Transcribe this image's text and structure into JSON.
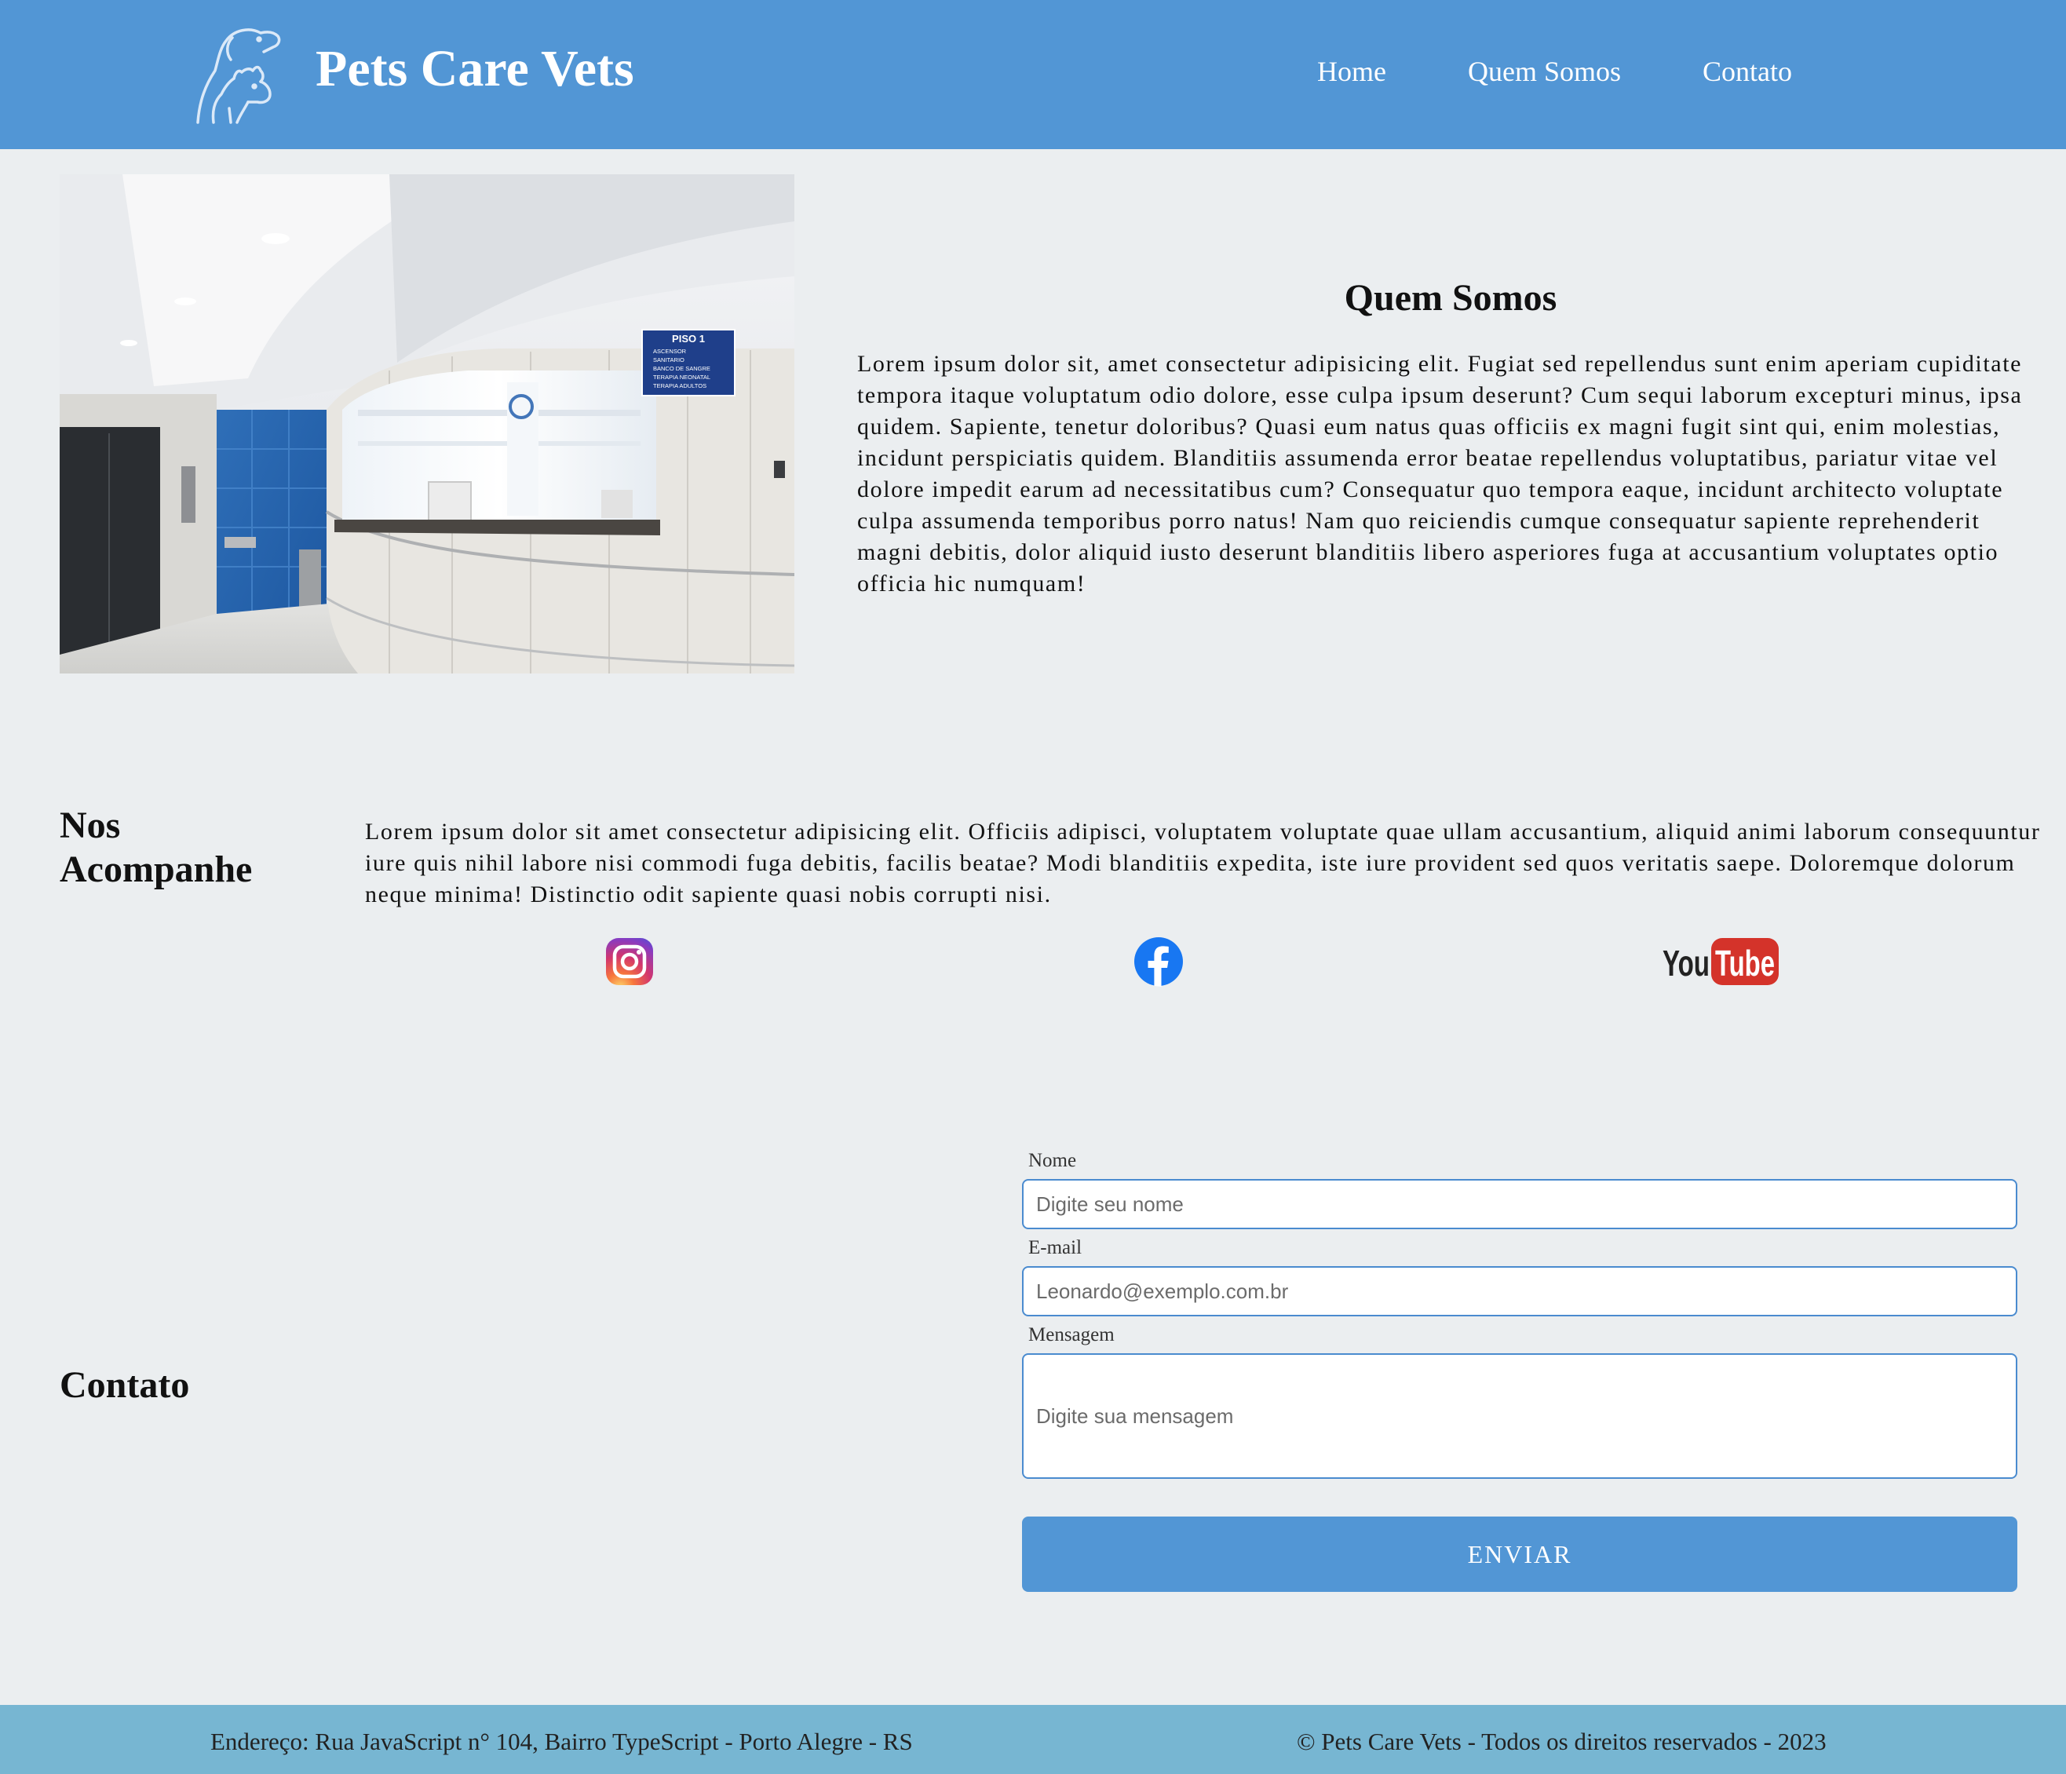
{
  "header": {
    "brand": "Pets Care Vets",
    "logo_icon": "dog-and-cat-outline-icon",
    "nav": [
      "Home",
      "Quem Somos",
      "Contato"
    ]
  },
  "about": {
    "image": "vet-clinic-reception-photo",
    "sign_title": "PISO 1",
    "sign_items": [
      "ASCENSOR",
      "SANITARIO",
      "BANCO DE SANGRE",
      "TERAPIA NEONATAL",
      "TERAPIA ADULTOS"
    ],
    "title": "Quem Somos",
    "text": "Lorem ipsum dolor sit, amet consectetur adipisicing elit. Fugiat sed repellendus sunt enim aperiam cupiditate tempora itaque voluptatum odio dolore, esse culpa ipsum deserunt? Cum sequi laborum excepturi minus, ipsa quidem. Sapiente, tenetur doloribus? Quasi eum natus quas officiis ex magni fugit sint qui, enim molestias, incidunt perspiciatis quidem. Blanditiis assumenda error beatae repellendus voluptatibus, pariatur vitae vel dolore impedit earum ad necessitatibus cum? Consequatur quo tempora eaque, incidunt architecto voluptate culpa assumenda temporibus porro natus! Nam quo reiciendis cumque consequatur sapiente reprehenderit magni debitis, dolor aliquid iusto deserunt blanditiis libero asperiores fuga at accusantium voluptates optio officia hic numquam!"
  },
  "follow": {
    "title": "Nos Acompanhe",
    "text": "Lorem ipsum dolor sit amet consectetur adipisicing elit. Officiis adipisci, voluptatem voluptate quae ullam accusantium, aliquid animi laborum consequuntur iure quis nihil labore nisi commodi fuga debitis, facilis beatae? Modi blanditiis expedita, iste iure provident sed quos veritatis saepe. Doloremque dolorum neque minima! Distinctio odit sapiente quasi nobis corrupti nisi.",
    "social": {
      "youtube_you": "You",
      "youtube_tube": "Tube"
    }
  },
  "contact": {
    "title": "Contato",
    "name_label": "Nome",
    "name_placeholder": "Digite seu nome",
    "email_label": "E-mail",
    "email_placeholder": "Leonardo@exemplo.com.br",
    "message_label": "Mensagem",
    "message_placeholder": "Digite sua mensagem",
    "submit": "ENVIAR"
  },
  "footer": {
    "address": "Endereço: Rua JavaScript n° 104, Bairro TypeScript - Porto Alegre - RS",
    "copyright": "© Pets Care Vets - Todos os direitos reservados - 2023"
  },
  "colors": {
    "header_bg": "#5296d5",
    "page_bg": "#ebeef0",
    "footer_bg": "#77b6d2",
    "button_bg": "#5296d5"
  }
}
